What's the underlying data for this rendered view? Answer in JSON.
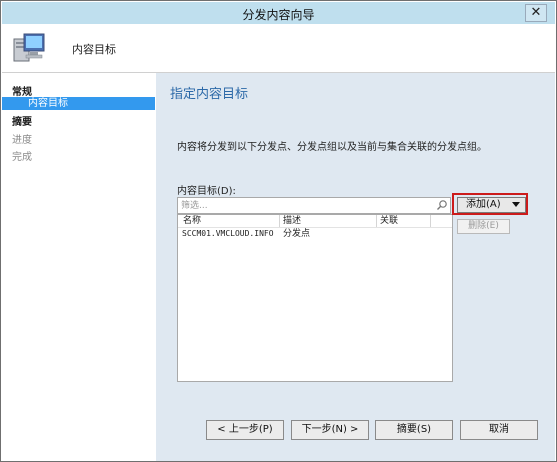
{
  "window": {
    "title": "分发内容向导",
    "close_glyph": "✕"
  },
  "banner": {
    "title": "内容目标",
    "icon": "computer-monitor-icon"
  },
  "sidebar": {
    "items": [
      {
        "label": "常规",
        "kind": "group"
      },
      {
        "label": "内容目标",
        "kind": "selected"
      },
      {
        "label": "摘要",
        "kind": "group"
      },
      {
        "label": "进度",
        "kind": "dim"
      },
      {
        "label": "完成",
        "kind": "dim"
      }
    ]
  },
  "main": {
    "page_title": "指定内容目标",
    "description": "内容将分发到以下分发点、分发点组以及当前与集合关联的分发点组。",
    "list_label": "内容目标(D):",
    "filter_placeholder": "筛选...",
    "columns": [
      "名称",
      "描述",
      "关联"
    ],
    "rows": [
      {
        "name": "SCCM01.VMCLOUD.INFO",
        "description": "分发点",
        "association": ""
      }
    ],
    "add_button": "添加(A)",
    "remove_button": "删除(E)"
  },
  "footer": {
    "prev": "< 上一步(P)",
    "next": "下一步(N) >",
    "summary": "摘要(S)",
    "cancel": "取消"
  },
  "colors": {
    "accent": "#3399ee",
    "title_text": "#2c69a8",
    "highlight": "#cc1b1b",
    "content_bg": "#dfe8f1",
    "titlebar_bg": "#bfdfee"
  }
}
